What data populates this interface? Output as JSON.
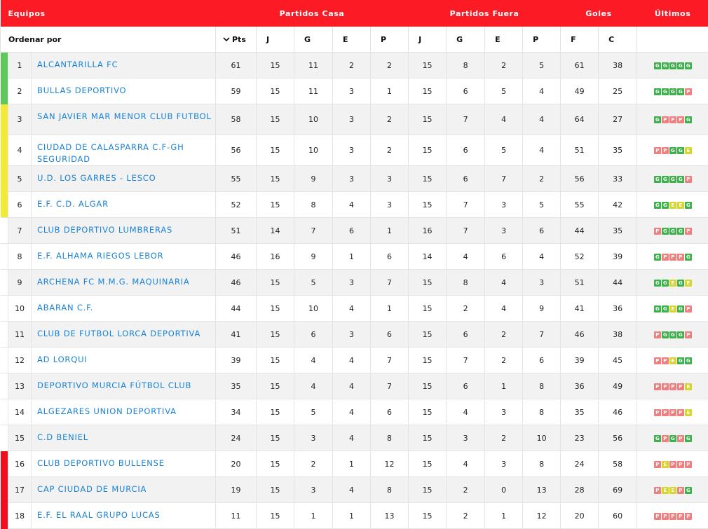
{
  "header": {
    "teams": "Equipos",
    "home": "Partidos Casa",
    "away": "Partidos Fuera",
    "goals": "Goles",
    "last": "Últimos"
  },
  "sort": {
    "label": "Ordenar por",
    "pts": "Pts",
    "home_j": "J",
    "home_g": "G",
    "home_e": "E",
    "home_p": "P",
    "away_j": "J",
    "away_g": "G",
    "away_e": "E",
    "away_p": "P",
    "gf": "F",
    "gc": "C"
  },
  "colors": {
    "header_bg": "#fc1b25",
    "zone_green": "#5ec85b",
    "zone_yellow": "#f3ea37",
    "zone_red": "#f20d1d",
    "result_G": "#3db24b",
    "result_E": "#d6d62f",
    "result_P": "#f08080"
  },
  "rows": [
    {
      "pos": "1",
      "team": "ALCANTARILLA FC",
      "pts": "61",
      "hj": "15",
      "hg": "11",
      "he": "2",
      "hp": "2",
      "aj": "15",
      "ag": "8",
      "ae": "2",
      "ap": "5",
      "gf": "61",
      "gc": "38",
      "last": [
        "G",
        "G",
        "G",
        "G",
        "G"
      ],
      "zone": "green"
    },
    {
      "pos": "2",
      "team": "BULLAS DEPORTIVO",
      "pts": "59",
      "hj": "15",
      "hg": "11",
      "he": "3",
      "hp": "1",
      "aj": "15",
      "ag": "6",
      "ae": "5",
      "ap": "4",
      "gf": "49",
      "gc": "25",
      "last": [
        "G",
        "G",
        "G",
        "G",
        "P"
      ],
      "zone": "green"
    },
    {
      "pos": "3",
      "team": "SAN JAVIER MAR MENOR CLUB FUTBOL",
      "pts": "58",
      "hj": "15",
      "hg": "10",
      "he": "3",
      "hp": "2",
      "aj": "15",
      "ag": "7",
      "ae": "4",
      "ap": "4",
      "gf": "64",
      "gc": "27",
      "last": [
        "G",
        "P",
        "P",
        "P",
        "G"
      ],
      "zone": "yellow"
    },
    {
      "pos": "4",
      "team": "CIUDAD DE CALASPARRA C.F-GH SEGURIDAD",
      "pts": "56",
      "hj": "15",
      "hg": "10",
      "he": "3",
      "hp": "2",
      "aj": "15",
      "ag": "6",
      "ae": "5",
      "ap": "4",
      "gf": "51",
      "gc": "35",
      "last": [
        "P",
        "P",
        "G",
        "G",
        "E"
      ],
      "zone": "yellow"
    },
    {
      "pos": "5",
      "team": "U.D. LOS GARRES - LESCO",
      "pts": "55",
      "hj": "15",
      "hg": "9",
      "he": "3",
      "hp": "3",
      "aj": "15",
      "ag": "6",
      "ae": "7",
      "ap": "2",
      "gf": "56",
      "gc": "33",
      "last": [
        "G",
        "G",
        "G",
        "G",
        "P"
      ],
      "zone": "yellow"
    },
    {
      "pos": "6",
      "team": "E.F. C.D. ALGAR",
      "pts": "52",
      "hj": "15",
      "hg": "8",
      "he": "4",
      "hp": "3",
      "aj": "15",
      "ag": "7",
      "ae": "3",
      "ap": "5",
      "gf": "55",
      "gc": "42",
      "last": [
        "G",
        "G",
        "E",
        "E",
        "G"
      ],
      "zone": "yellow"
    },
    {
      "pos": "7",
      "team": "CLUB DEPORTIVO LUMBRERAS",
      "pts": "51",
      "hj": "14",
      "hg": "7",
      "he": "6",
      "hp": "1",
      "aj": "16",
      "ag": "7",
      "ae": "3",
      "ap": "6",
      "gf": "44",
      "gc": "35",
      "last": [
        "P",
        "G",
        "G",
        "G",
        "P"
      ],
      "zone": "none"
    },
    {
      "pos": "8",
      "team": "E.F. ALHAMA RIEGOS LEBOR",
      "pts": "46",
      "hj": "16",
      "hg": "9",
      "he": "1",
      "hp": "6",
      "aj": "14",
      "ag": "4",
      "ae": "6",
      "ap": "4",
      "gf": "52",
      "gc": "39",
      "last": [
        "G",
        "P",
        "P",
        "P",
        "G"
      ],
      "zone": "none"
    },
    {
      "pos": "9",
      "team": "ARCHENA FC M.M.G. MAQUINARIA",
      "pts": "46",
      "hj": "15",
      "hg": "5",
      "he": "3",
      "hp": "7",
      "aj": "15",
      "ag": "8",
      "ae": "4",
      "ap": "3",
      "gf": "51",
      "gc": "44",
      "last": [
        "G",
        "G",
        "E",
        "G",
        "E"
      ],
      "zone": "none"
    },
    {
      "pos": "10",
      "team": "ABARAN C.F.",
      "pts": "44",
      "hj": "15",
      "hg": "10",
      "he": "4",
      "hp": "1",
      "aj": "15",
      "ag": "2",
      "ae": "4",
      "ap": "9",
      "gf": "41",
      "gc": "36",
      "last": [
        "G",
        "G",
        "E",
        "G",
        "P"
      ],
      "zone": "none"
    },
    {
      "pos": "11",
      "team": "CLUB DE FUTBOL LORCA DEPORTIVA",
      "pts": "41",
      "hj": "15",
      "hg": "6",
      "he": "3",
      "hp": "6",
      "aj": "15",
      "ag": "6",
      "ae": "2",
      "ap": "7",
      "gf": "46",
      "gc": "38",
      "last": [
        "P",
        "G",
        "G",
        "G",
        "P"
      ],
      "zone": "none"
    },
    {
      "pos": "12",
      "team": "AD LORQUI",
      "pts": "39",
      "hj": "15",
      "hg": "4",
      "he": "4",
      "hp": "7",
      "aj": "15",
      "ag": "7",
      "ae": "2",
      "ap": "6",
      "gf": "39",
      "gc": "45",
      "last": [
        "P",
        "P",
        "E",
        "G",
        "G"
      ],
      "zone": "none"
    },
    {
      "pos": "13",
      "team": "DEPORTIVO MURCIA FÚTBOL CLUB",
      "pts": "35",
      "hj": "15",
      "hg": "4",
      "he": "4",
      "hp": "7",
      "aj": "15",
      "ag": "6",
      "ae": "1",
      "ap": "8",
      "gf": "36",
      "gc": "49",
      "last": [
        "P",
        "P",
        "P",
        "P",
        "E"
      ],
      "zone": "none"
    },
    {
      "pos": "14",
      "team": "ALGEZARES UNION DEPORTIVA",
      "pts": "34",
      "hj": "15",
      "hg": "5",
      "he": "4",
      "hp": "6",
      "aj": "15",
      "ag": "4",
      "ae": "3",
      "ap": "8",
      "gf": "35",
      "gc": "46",
      "last": [
        "P",
        "P",
        "P",
        "P",
        "E"
      ],
      "zone": "none"
    },
    {
      "pos": "15",
      "team": "C.D BENIEL",
      "pts": "24",
      "hj": "15",
      "hg": "3",
      "he": "4",
      "hp": "8",
      "aj": "15",
      "ag": "3",
      "ae": "2",
      "ap": "10",
      "gf": "23",
      "gc": "56",
      "last": [
        "G",
        "P",
        "G",
        "P",
        "G"
      ],
      "zone": "none"
    },
    {
      "pos": "16",
      "team": "CLUB DEPORTIVO BULLENSE",
      "pts": "20",
      "hj": "15",
      "hg": "2",
      "he": "1",
      "hp": "12",
      "aj": "15",
      "ag": "4",
      "ae": "3",
      "ap": "8",
      "gf": "24",
      "gc": "58",
      "last": [
        "P",
        "E",
        "P",
        "P",
        "P"
      ],
      "zone": "red"
    },
    {
      "pos": "17",
      "team": "CAP CIUDAD DE MURCIA",
      "pts": "19",
      "hj": "15",
      "hg": "3",
      "he": "4",
      "hp": "8",
      "aj": "15",
      "ag": "2",
      "ae": "0",
      "ap": "13",
      "gf": "28",
      "gc": "69",
      "last": [
        "P",
        "E",
        "E",
        "P",
        "G"
      ],
      "zone": "red"
    },
    {
      "pos": "18",
      "team": "E.F. EL RAAL GRUPO LUCAS",
      "pts": "11",
      "hj": "15",
      "hg": "1",
      "he": "1",
      "hp": "13",
      "aj": "15",
      "ag": "2",
      "ae": "1",
      "ap": "12",
      "gf": "20",
      "gc": "60",
      "last": [
        "P",
        "P",
        "P",
        "P",
        "P"
      ],
      "zone": "red"
    }
  ]
}
